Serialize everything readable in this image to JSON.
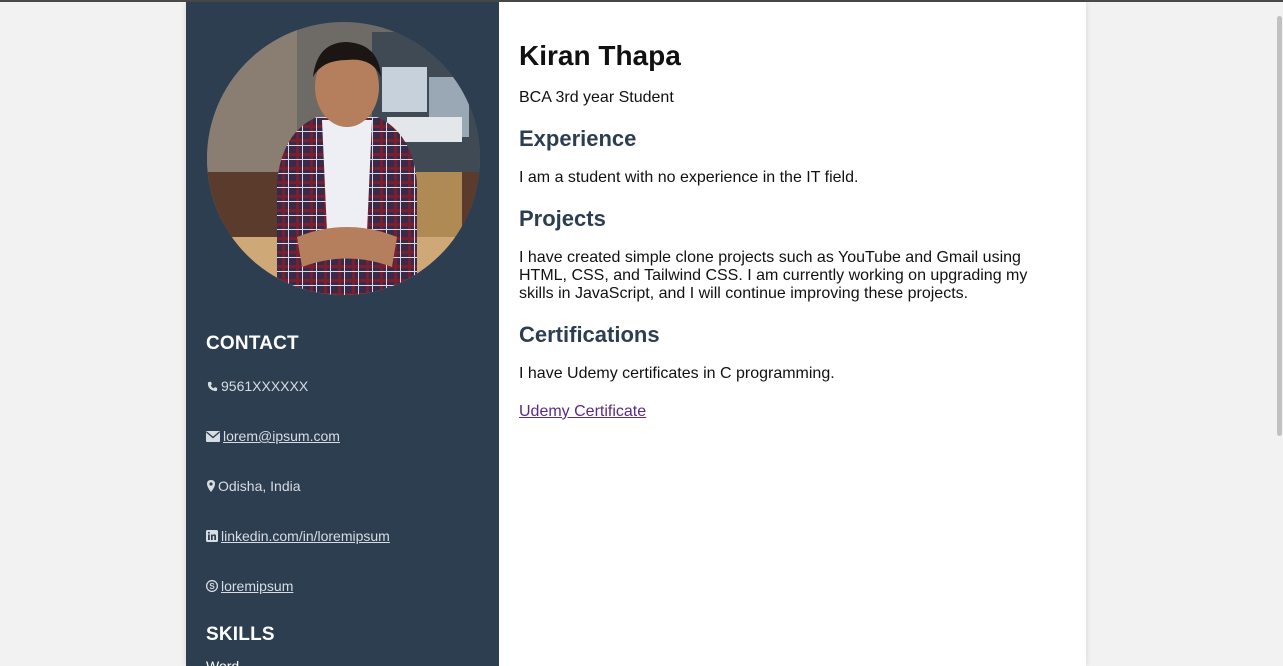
{
  "profile": {
    "name": "Kiran Thapa",
    "title": "BCA 3rd year Student",
    "photo_alt": "Profile photo"
  },
  "contact": {
    "heading": "CONTACT",
    "phone": "9561XXXXXX",
    "email": "lorem@ipsum.com",
    "location": "Odisha, India",
    "linkedin": "linkedin.com/in/loremipsum",
    "skype": "loremipsum"
  },
  "skills": {
    "heading": "SKILLS",
    "first_item": "Word"
  },
  "sections": {
    "experience": {
      "heading": "Experience",
      "text": "I am a student with no experience in the IT field."
    },
    "projects": {
      "heading": "Projects",
      "text": "I have created simple clone projects such as YouTube and Gmail using HTML, CSS, and Tailwind CSS. I am currently working on upgrading my skills in JavaScript, and I will continue improving these projects."
    },
    "certifications": {
      "heading": "Certifications",
      "text": "I have Udemy certificates in C programming.",
      "link_label": "Udemy Certificate"
    }
  },
  "colors": {
    "sidebar_bg": "#2d3e50",
    "heading_color": "#2d3e50",
    "link_color": "#5b2a86"
  },
  "icons": {
    "phone": "phone-icon",
    "email": "envelope-icon",
    "location": "map-marker-icon",
    "linkedin": "linkedin-icon",
    "skype": "skype-icon"
  }
}
